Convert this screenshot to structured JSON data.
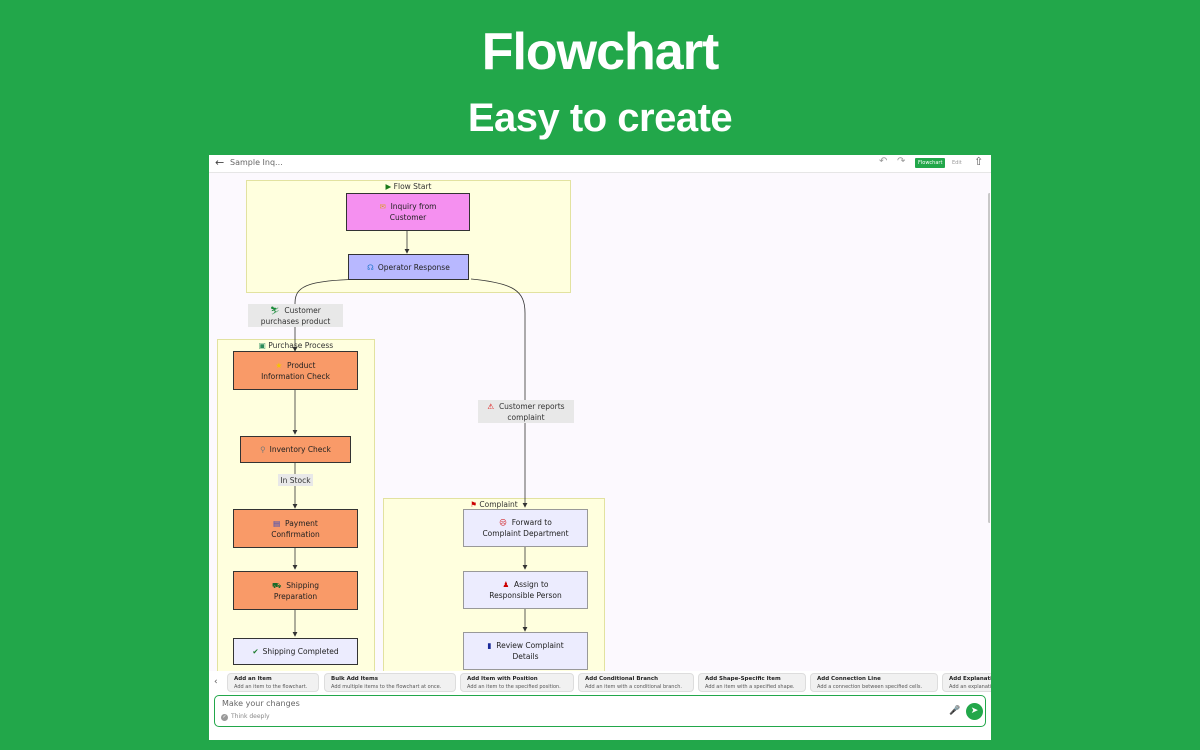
{
  "hero": {
    "title": "Flowchart",
    "subtitle": "Easy to create"
  },
  "topbar": {
    "doc_title": "Sample Inq...",
    "mode_flowchart": "Flowchart",
    "mode_edit": "Edit",
    "back_icon": "arrow-left-icon",
    "undo_icon": "undo-icon",
    "redo_icon": "redo-icon",
    "share_icon": "share-icon"
  },
  "colors": {
    "brand_green": "#22a74a",
    "start_node": "#f590f0",
    "operator_node": "#b8b8ff",
    "process_node": "#f99a68",
    "complaint_node": "#ececfe",
    "group_fill": "#ffffde"
  },
  "flow": {
    "groups": {
      "flow_start": "Flow Start",
      "purchase": "Purchase Process",
      "complaint": "Complaint"
    },
    "nodes": {
      "inquiry_l1": "Inquiry from",
      "inquiry_l2": "Customer",
      "operator": "Operator Response",
      "product_l1": "Product",
      "product_l2": "Information Check",
      "inventory": "Inventory Check",
      "payment_l1": "Payment",
      "payment_l2": "Confirmation",
      "shipping_prep_l1": "Shipping",
      "shipping_prep_l2": "Preparation",
      "shipping_done": "Shipping Completed",
      "forward_l1": "Forward to",
      "forward_l2": "Complaint Department",
      "assign_l1": "Assign to",
      "assign_l2": "Responsible Person",
      "review_l1": "Review Complaint",
      "review_l2": "Details"
    },
    "edge_labels": {
      "purchases_l1": "Customer",
      "purchases_l2": "purchases product",
      "in_stock": "In Stock",
      "complaint_l1": "Customer reports",
      "complaint_l2": "complaint"
    }
  },
  "chips": [
    {
      "title": "Add an Item",
      "desc": "Add an item to the flowchart."
    },
    {
      "title": "Bulk Add Items",
      "desc": "Add multiple items to the flowchart at once."
    },
    {
      "title": "Add Item with Position",
      "desc": "Add an item to the specified position."
    },
    {
      "title": "Add Conditional Branch",
      "desc": "Add an item with a conditional branch."
    },
    {
      "title": "Add Shape-Specific Item",
      "desc": "Add an item with a specified shape."
    },
    {
      "title": "Add Connection Line",
      "desc": "Add a connection between specified cells."
    },
    {
      "title": "Add Explanation",
      "desc": "Add an explanation"
    }
  ],
  "composer": {
    "placeholder": "Make your changes",
    "think_deeply": "Think deeply"
  }
}
